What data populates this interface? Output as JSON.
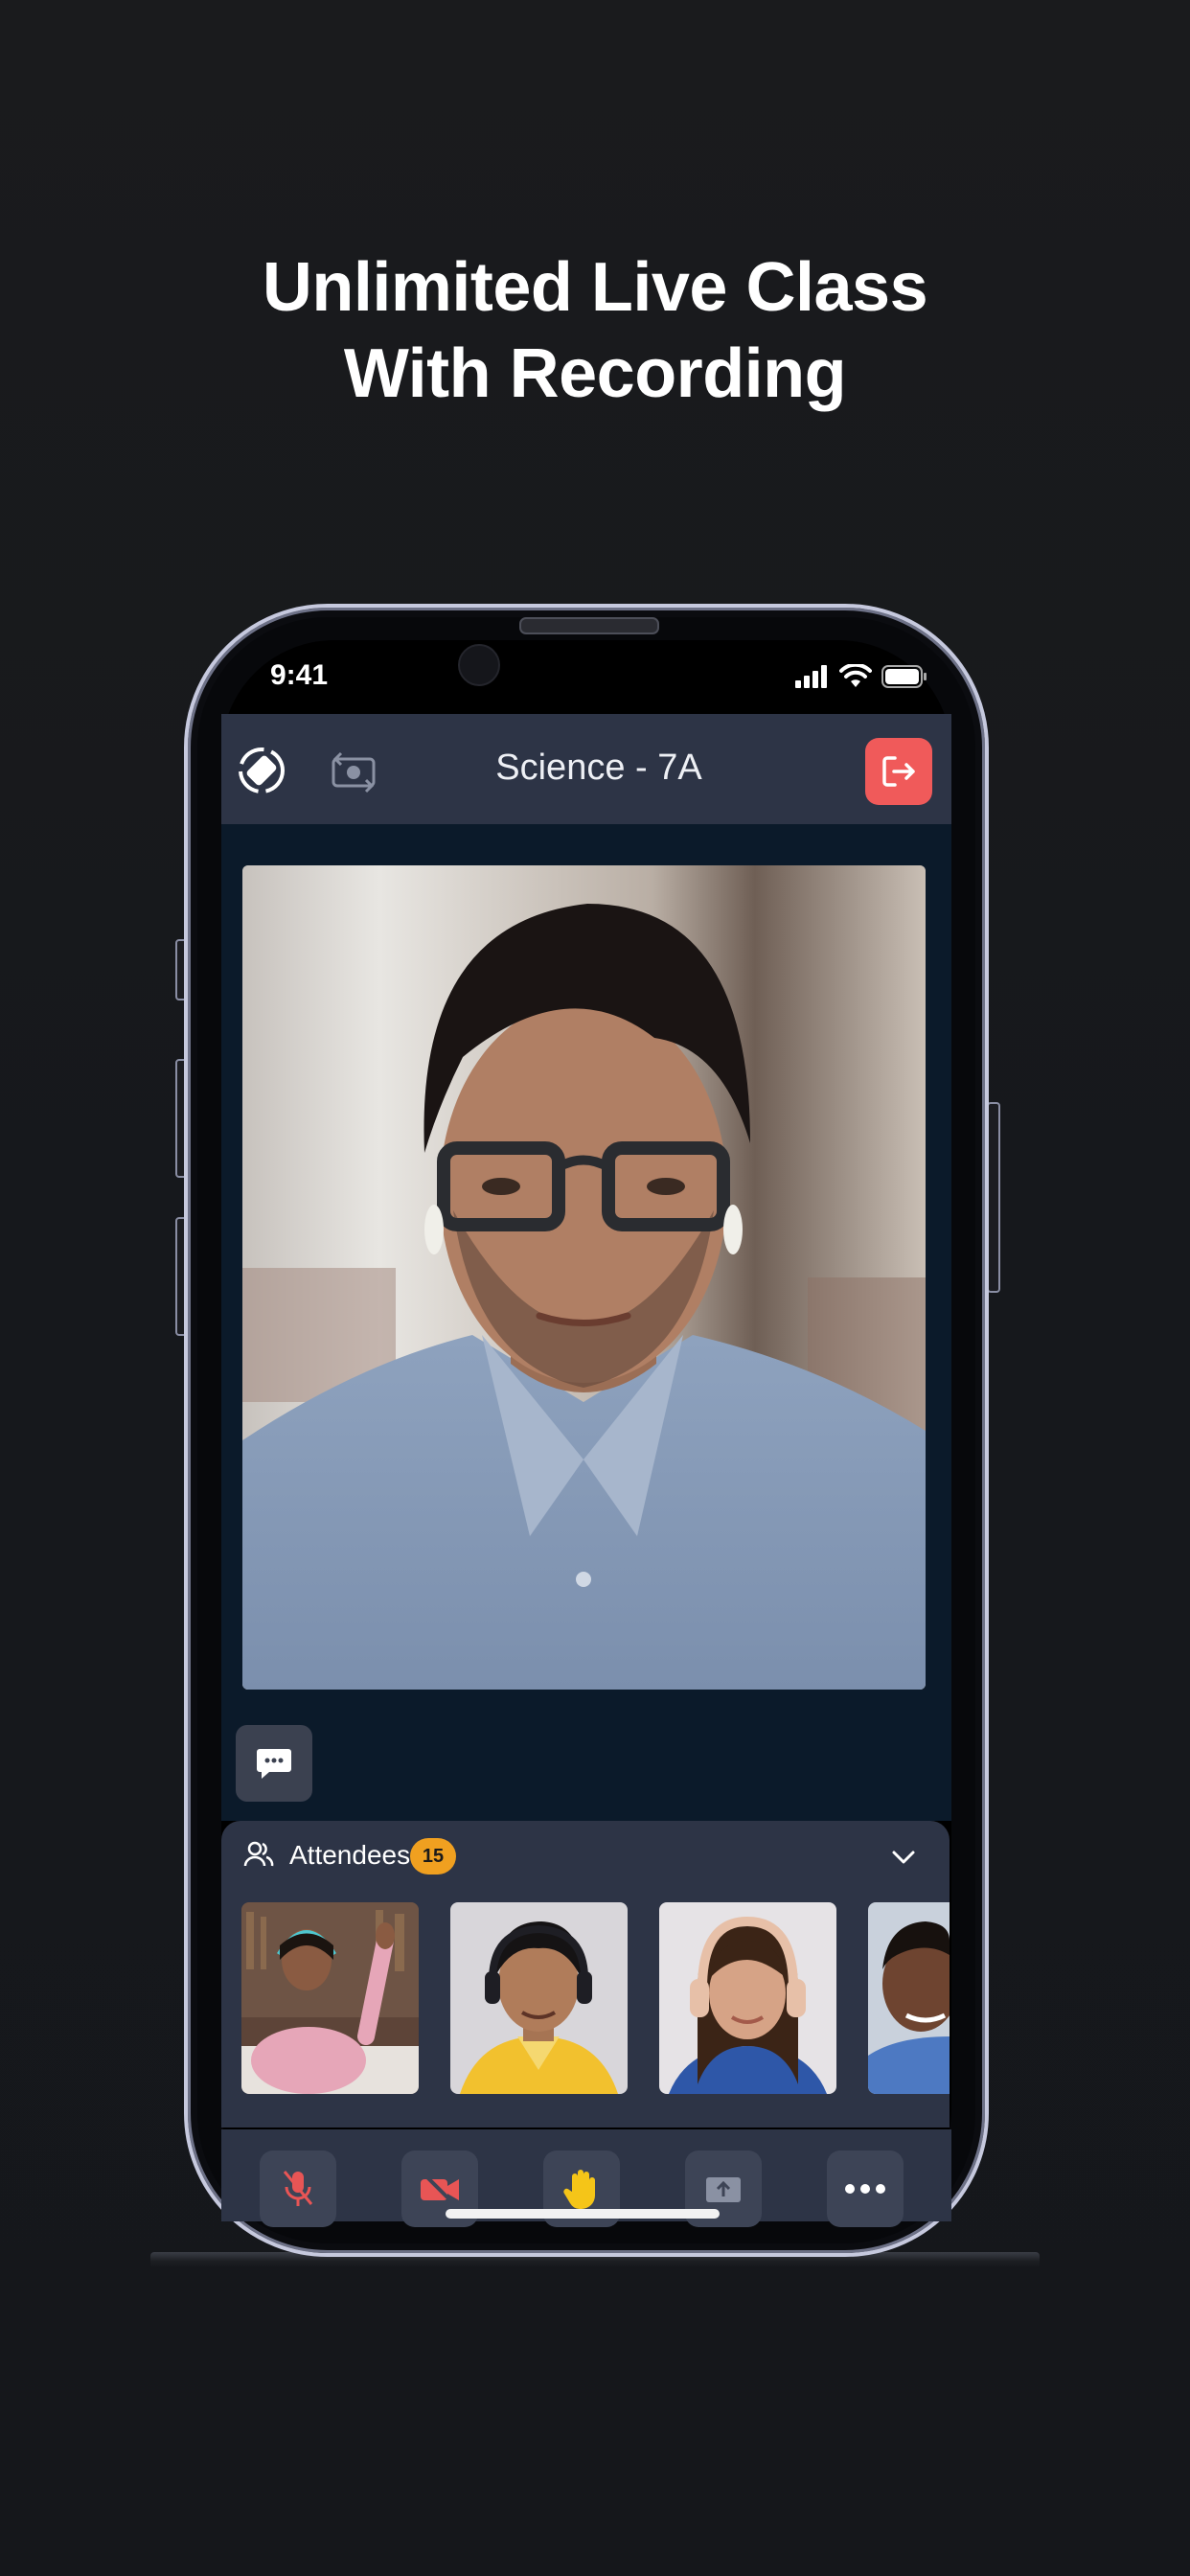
{
  "headline": {
    "line1": "Unlimited Live Class",
    "line2": "With Recording"
  },
  "status_bar": {
    "time": "9:41"
  },
  "app": {
    "class_title": "Science - 7A",
    "icons": {
      "rotate": "rotate-screen-icon",
      "switch_camera": "switch-camera-icon",
      "exit": "exit-icon",
      "chat": "chat-icon"
    }
  },
  "attendees": {
    "label": "Attendees",
    "count": "15"
  },
  "controls": [
    "mic-off-icon",
    "video-off-icon",
    "raise-hand-icon",
    "share-icon",
    "more-icon"
  ],
  "colors": {
    "exit_button": "#f05a5a",
    "badge": "#f0a020",
    "muted": "#e85555",
    "hand": "#f5c518"
  }
}
